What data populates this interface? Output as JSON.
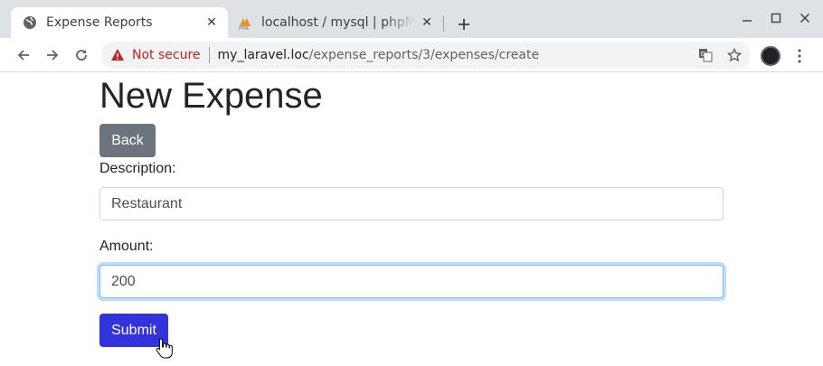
{
  "browser": {
    "tabs": [
      {
        "title": "Expense Reports",
        "icon": "globe-icon",
        "active": true
      },
      {
        "title": "localhost / mysql | phpMyAdmin",
        "icon": "phpmyadmin-icon",
        "active": false
      }
    ],
    "close_glyph": "✕",
    "security_label": "Not secure",
    "url_host": "my_laravel.loc",
    "url_path": "/expense_reports/3/expenses/create"
  },
  "page": {
    "title": "New Expense",
    "back_label": "Back",
    "description_label": "Description:",
    "description_value": "Restaurant",
    "amount_label": "Amount:",
    "amount_value": "200",
    "submit_label": "Submit"
  },
  "colors": {
    "back_button": "#6c757d",
    "submit_button": "#3333dd",
    "not_secure": "#c5221f",
    "focus_ring": "#80bdff"
  }
}
